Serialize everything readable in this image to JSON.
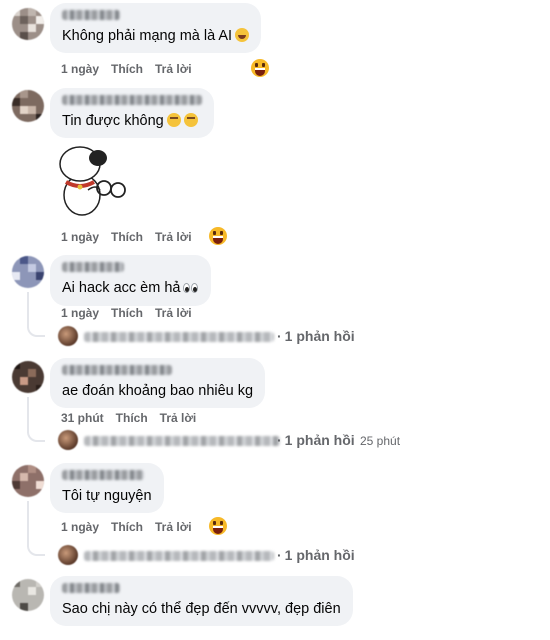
{
  "comments": [
    {
      "text": "Không phải mạng mà là AI",
      "emoji": "rolling-laughing-emoji",
      "actions": {
        "time": "1 ngày",
        "like": "Thích",
        "reply": "Trả lời"
      },
      "reaction": "haha-reaction-icon",
      "reaction_count": 1
    },
    {
      "text": "Tin được không",
      "emoji": "smirk-emoji",
      "sticker": "brian-dog-sticker",
      "actions": {
        "time": "1 ngày",
        "like": "Thích",
        "reply": "Trả lời"
      },
      "reaction": "haha-reaction-icon",
      "reaction_count": 1
    },
    {
      "text": "Ai hack acc èm hả",
      "emoji": "eyes-emoji",
      "actions": {
        "time": "1 ngày",
        "like": "Thích",
        "reply": "Trả lời"
      },
      "replies": {
        "count_label": "1 phản hồi",
        "time": ""
      }
    },
    {
      "text": "ae đoán khoảng bao nhiêu kg",
      "actions": {
        "time": "31 phút",
        "like": "Thích",
        "reply": "Trả lời"
      },
      "replies": {
        "count_label": "1 phản hồi",
        "time": "25 phút"
      }
    },
    {
      "text": "Tôi tự nguyện",
      "actions": {
        "time": "1 ngày",
        "like": "Thích",
        "reply": "Trả lời"
      },
      "reaction": "haha-reaction-icon",
      "reaction_count": 1,
      "replies": {
        "count_label": "1 phản hồi",
        "time": ""
      }
    },
    {
      "text": "Sao chị này có thể đẹp đến vvvvv, đẹp điên"
    }
  ],
  "colors": {
    "bubble": "#f0f2f5",
    "meta_text": "#65676b",
    "thread_line": "#e4e6eb",
    "reaction": "#f7b928"
  }
}
